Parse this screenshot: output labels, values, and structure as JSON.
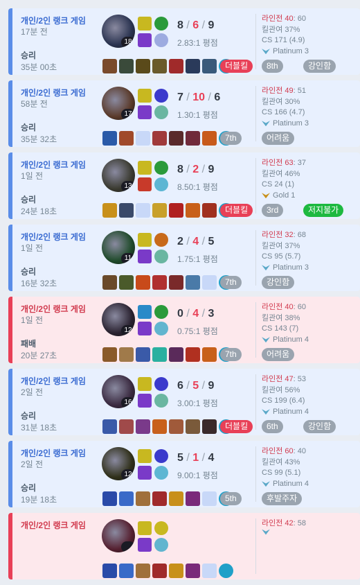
{
  "matches": [
    {
      "result_type": "win",
      "queue": "개인/2인 랭크 게임",
      "ago": "17분 전",
      "result": "승리",
      "duration": "35분 00초",
      "level": "18",
      "kills": "8",
      "deaths": "6",
      "assists": "9",
      "ratio": "2.83:1 평점",
      "lane": "라인전 40",
      "lane_opp": ": 60",
      "kp": "킬관여 37%",
      "cs": "CS 171 (4.9)",
      "rank": "Platinum 3",
      "rank_icon": "platinum-icon",
      "tags": [
        "더블킬",
        "8th",
        "강인함"
      ],
      "tag_colors": [
        "red",
        "gray",
        "gray"
      ]
    },
    {
      "result_type": "win",
      "queue": "개인/2인 랭크 게임",
      "ago": "58분 전",
      "result": "승리",
      "duration": "35분 32초",
      "level": "17",
      "kills": "7",
      "deaths": "10",
      "assists": "6",
      "ratio": "1.30:1 평점",
      "lane": "라인전 49",
      "lane_opp": ": 51",
      "kp": "킬관여 30%",
      "cs": "CS 166 (4.7)",
      "rank": "Platinum 3",
      "rank_icon": "platinum-icon",
      "tags": [
        "7th",
        "어려움"
      ],
      "tag_colors": [
        "gray",
        "gray"
      ]
    },
    {
      "result_type": "win",
      "queue": "개인/2인 랭크 게임",
      "ago": "1일 전",
      "result": "승리",
      "duration": "24분 18초",
      "level": "13",
      "kills": "8",
      "deaths": "2",
      "assists": "9",
      "ratio": "8.50:1 평점",
      "lane": "라인전 63",
      "lane_opp": ": 37",
      "kp": "킬관여 46%",
      "cs": "CS 24 (1)",
      "rank": "Gold 1",
      "rank_icon": "gold-icon",
      "tags": [
        "더블킬",
        "3rd",
        "저지불가"
      ],
      "tag_colors": [
        "red",
        "gray",
        "green"
      ]
    },
    {
      "result_type": "win",
      "queue": "개인/2인 랭크 게임",
      "ago": "1일 전",
      "result": "승리",
      "duration": "16분 32초",
      "level": "11",
      "kills": "2",
      "deaths": "4",
      "assists": "5",
      "ratio": "1.75:1 평점",
      "lane": "라인전 32",
      "lane_opp": ": 68",
      "kp": "킬관여 37%",
      "cs": "CS 95 (5.7)",
      "rank": "Platinum 3",
      "rank_icon": "platinum-icon",
      "tags": [
        "7th",
        "강인함"
      ],
      "tag_colors": [
        "gray",
        "gray"
      ]
    },
    {
      "result_type": "loss",
      "queue": "개인/2인 랭크 게임",
      "ago": "1일 전",
      "result": "패배",
      "duration": "20분 27초",
      "level": "12",
      "kills": "0",
      "deaths": "4",
      "assists": "3",
      "ratio": "0.75:1 평점",
      "lane": "라인전 40",
      "lane_opp": ": 60",
      "kp": "킬관여 38%",
      "cs": "CS 143 (7)",
      "rank": "Platinum 4",
      "rank_icon": "platinum-icon",
      "tags": [
        "7th",
        "어려움"
      ],
      "tag_colors": [
        "gray",
        "gray"
      ]
    },
    {
      "result_type": "win",
      "queue": "개인/2인 랭크 게임",
      "ago": "2일 전",
      "result": "승리",
      "duration": "31분 18초",
      "level": "16",
      "kills": "6",
      "deaths": "5",
      "assists": "9",
      "ratio": "3.00:1 평점",
      "lane": "라인전 47",
      "lane_opp": ": 53",
      "kp": "킬관여 56%",
      "cs": "CS 199 (6.4)",
      "rank": "Platinum 4",
      "rank_icon": "platinum-icon",
      "tags": [
        "더블킬",
        "6th",
        "강인함"
      ],
      "tag_colors": [
        "red",
        "gray",
        "gray"
      ]
    },
    {
      "result_type": "win",
      "queue": "개인/2인 랭크 게임",
      "ago": "2일 전",
      "result": "승리",
      "duration": "19분 18초",
      "level": "12",
      "kills": "5",
      "deaths": "1",
      "assists": "4",
      "ratio": "9.00:1 평점",
      "lane": "라인전 60",
      "lane_opp": ": 40",
      "kp": "킬관여 43%",
      "cs": "CS 99 (5.1)",
      "rank": "Platinum 4",
      "rank_icon": "platinum-icon",
      "tags": [
        "5th",
        "후발주자"
      ],
      "tag_colors": [
        "gray",
        "gray"
      ]
    },
    {
      "result_type": "loss",
      "queue": "개인/2인 랭크 게임",
      "ago": "",
      "result": "",
      "duration": "",
      "level": "",
      "kills": "",
      "deaths": "",
      "assists": "",
      "ratio": "",
      "lane": "라인전 42",
      "lane_opp": ": 58",
      "kp": "",
      "cs": "",
      "rank": "",
      "rank_icon": "platinum-icon",
      "tags": [],
      "tag_colors": []
    }
  ],
  "colors": {
    "win_bg": "#e8f0fe",
    "loss_bg": "#fde8ec",
    "win_accent": "#5a8de8",
    "loss_accent": "#e84057"
  }
}
